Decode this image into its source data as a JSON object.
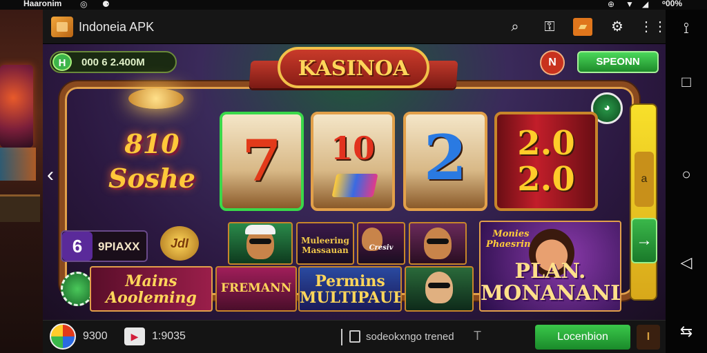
{
  "status_bar": {
    "left": "Haaronim",
    "right": "ᵒ00%"
  },
  "left_arcade": {},
  "appbar": {
    "title": "Indoneia APK",
    "icons": [
      "search-icon",
      "lock-person-icon",
      "flag-icon",
      "gear-icon",
      "grid-icon"
    ]
  },
  "game": {
    "balance": {
      "coin": "H",
      "text": "000 6 2.400M"
    },
    "title": "KASINOA",
    "close": "N",
    "spin_label": "SPEONN",
    "chip": "◕",
    "big_logo": "810\nSoshe",
    "reels": [
      {
        "symbol": "7"
      },
      {
        "symbol": "10"
      },
      {
        "symbol": "2"
      },
      {
        "symbol": "2.0\n2.0"
      }
    ],
    "side_slot": "a",
    "side_arrow": "→",
    "left_arrow": "‹",
    "badge_num": "6",
    "badge_text": "9PIAXX",
    "gold_coin": "JdI",
    "tiles": {
      "pers2": "Muleering\nMassauan",
      "pers3": "Cresiv",
      "m1": "Mains\nAooleming",
      "m2": "FREMANN",
      "m3": "Permins\nMULTIPAUEN",
      "big_top": "Monies\nPhaesrins",
      "big": "PLAN.\nMONANANL"
    }
  },
  "bottom_bar": {
    "t1": "9300",
    "t2": "1:9035",
    "t3": "sodeokxngo trened",
    "pin": "T",
    "green_btn": "Locenbion",
    "menu_btn": "I"
  },
  "nav": {
    "icons": [
      "accessibility-icon",
      "square-icon",
      "circle-icon",
      "back-icon",
      "rotate-icon"
    ]
  }
}
